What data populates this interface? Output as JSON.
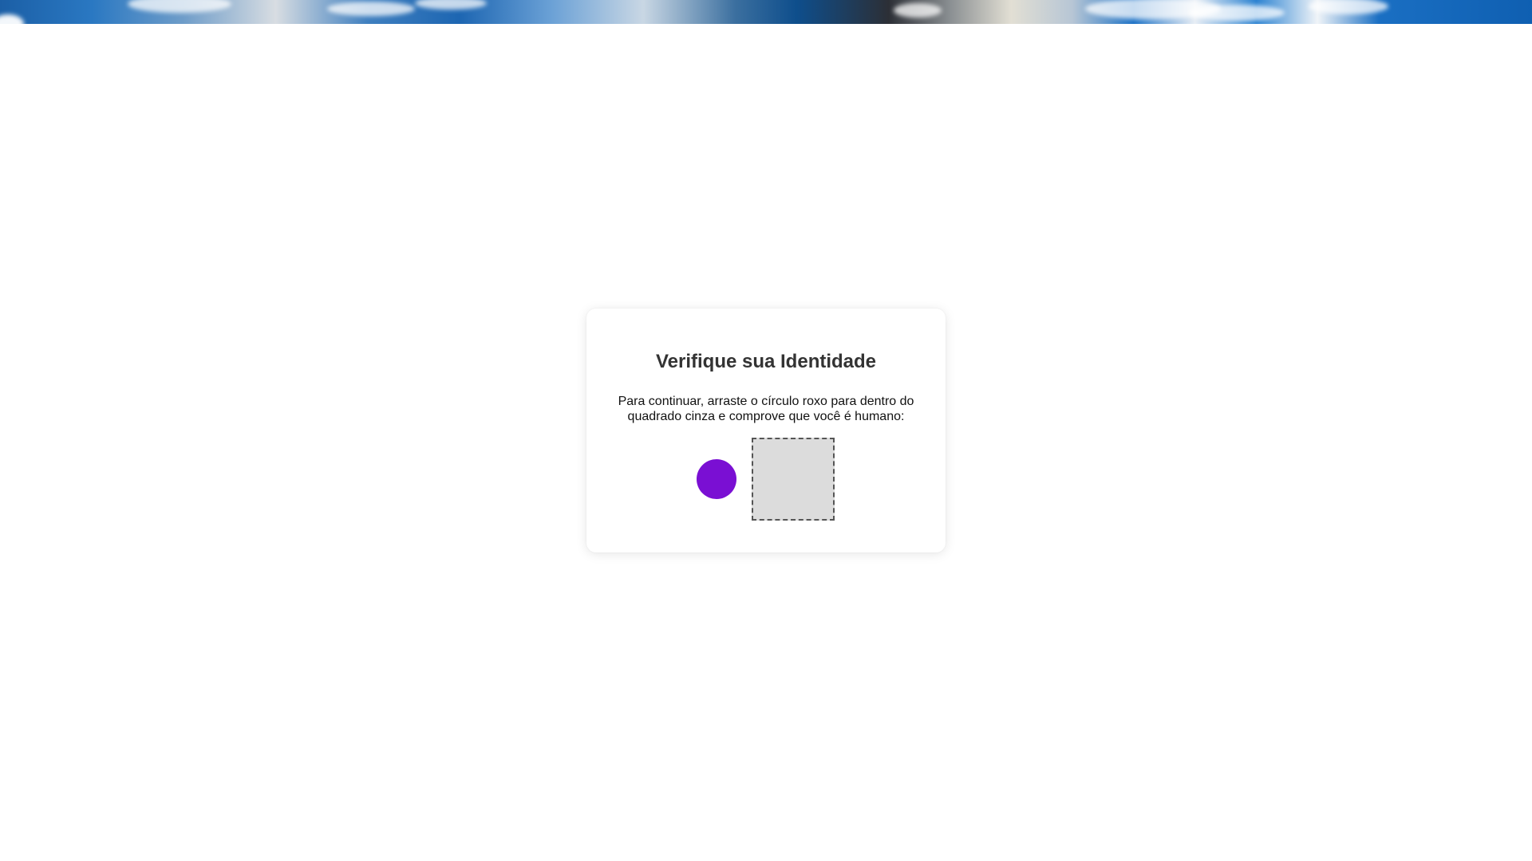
{
  "banner": {
    "image": "sky-clouds-banner"
  },
  "captcha": {
    "title": "Verifique sua Identidade",
    "instructions": "Para continuar, arraste o círculo roxo para dentro do quadrado cinza e comprove que você é humano:",
    "draggable": {
      "shape": "circle",
      "color": "#7a0fd3"
    },
    "target": {
      "shape": "square",
      "color": "#dcdcdc",
      "border_color": "#555555",
      "border_style": "dashed"
    }
  }
}
